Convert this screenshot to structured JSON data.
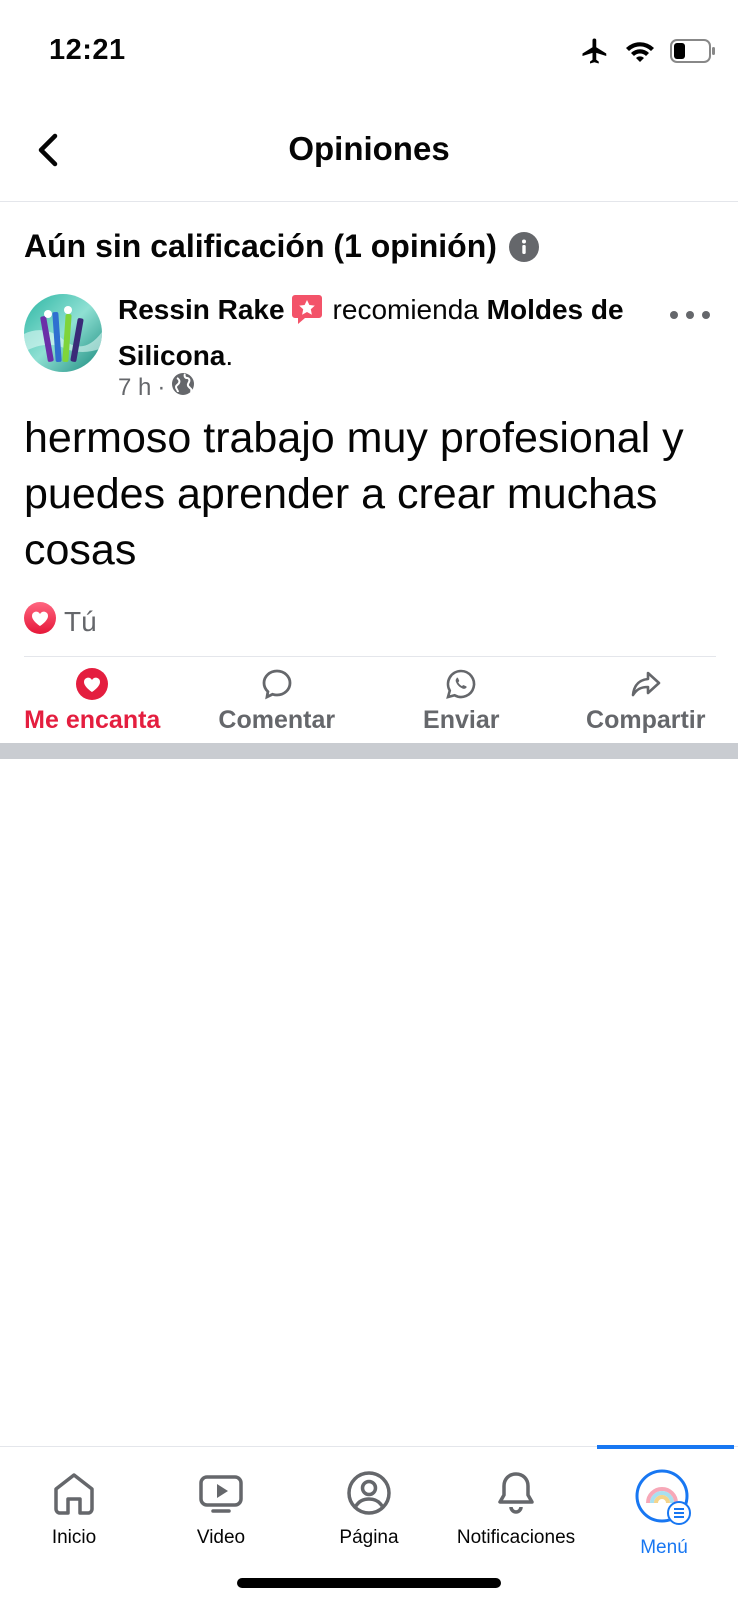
{
  "status_bar": {
    "time": "12:21"
  },
  "header": {
    "title": "Opiniones"
  },
  "rating": {
    "title": "Aún sin calificación (1 opinión)"
  },
  "review": {
    "author": "Ressin Rake",
    "verb": "recomienda",
    "page": "Moldes de Silicona",
    "punct": ".",
    "time": "7 h",
    "separator": "·",
    "text": "hermoso trabajo muy profesional y puedes aprender a crear muchas cosas",
    "reaction_by": "Tú"
  },
  "actions": [
    {
      "label": "Me encanta"
    },
    {
      "label": "Comentar"
    },
    {
      "label": "Enviar"
    },
    {
      "label": "Compartir"
    }
  ],
  "tabs": [
    {
      "label": "Inicio"
    },
    {
      "label": "Video"
    },
    {
      "label": "Página"
    },
    {
      "label": "Notificaciones"
    },
    {
      "label": "Menú"
    }
  ],
  "colors": {
    "accent": "#1877f2",
    "love": "#e41e3f",
    "secondary_text": "#65676b",
    "separator": "#c9ccd1"
  }
}
